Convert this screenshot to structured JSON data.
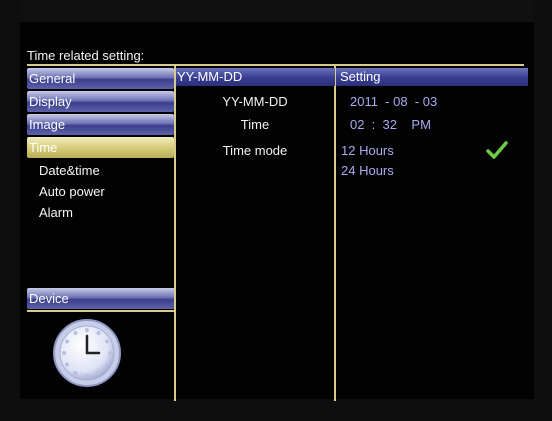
{
  "header": {
    "title": "Time related setting:"
  },
  "menu": {
    "items": [
      {
        "label": "General"
      },
      {
        "label": "Display"
      },
      {
        "label": "Image"
      },
      {
        "label": "Time",
        "active": true
      }
    ],
    "submenu": [
      "Date&time",
      "Auto power",
      "Alarm"
    ],
    "device_label": "Device"
  },
  "middle": {
    "header": "YY-MM-DD",
    "rows": [
      "YY-MM-DD",
      "Time",
      "Time mode"
    ]
  },
  "right": {
    "header": "Setting",
    "date": "2011  - 08  - 03",
    "time": "02  :  32    PM",
    "options": [
      "12 Hours",
      "24 Hours"
    ],
    "selected_option": "12 Hours"
  },
  "icons": {
    "clock": "clock-icon",
    "check": "checkmark-icon"
  },
  "colors": {
    "menu_blue": "#3b3f8c",
    "active_gold": "#d7cd7c",
    "divider": "#d8cc8c",
    "option_text": "#a9aaf0",
    "check_green": "#6ecb4c"
  }
}
